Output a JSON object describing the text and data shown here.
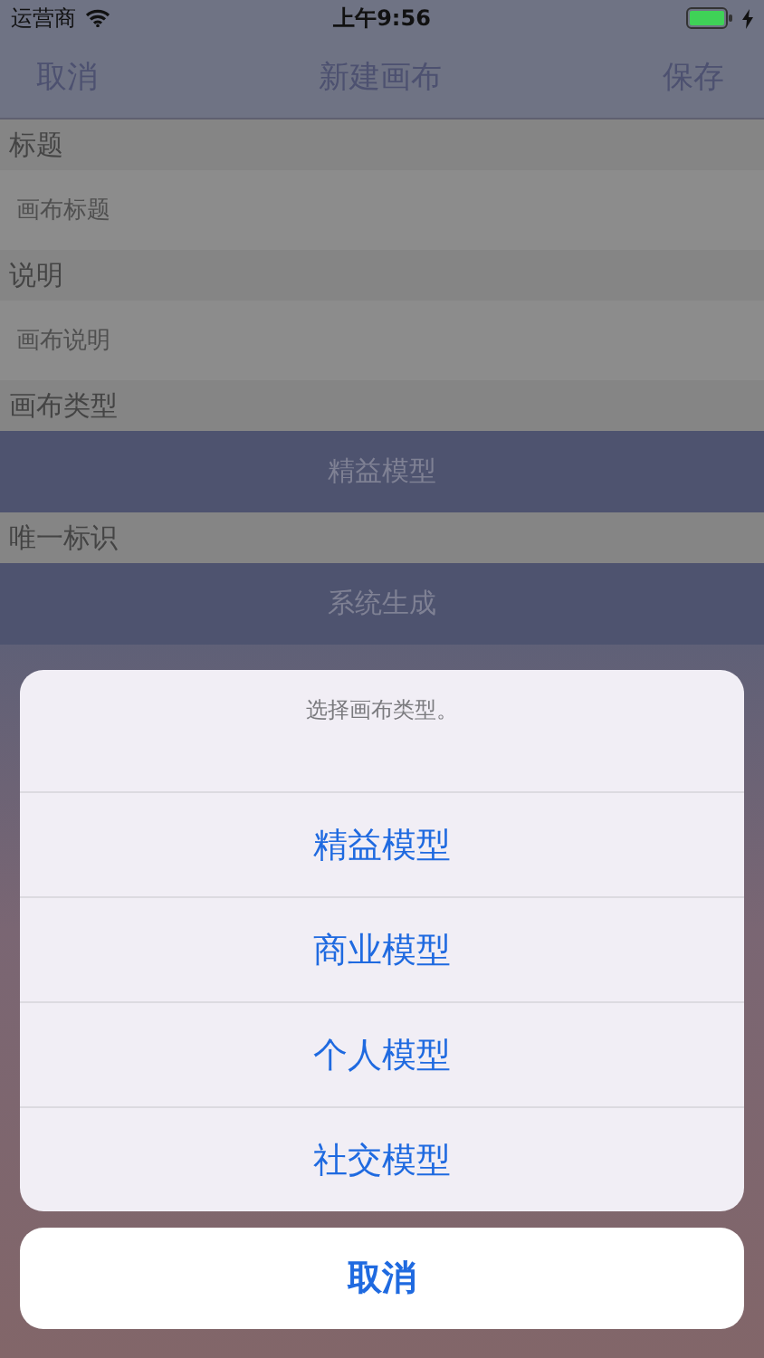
{
  "status_bar": {
    "carrier": "运营商",
    "time": "上午9:56"
  },
  "nav": {
    "left": "取消",
    "title": "新建画布",
    "right": "保存"
  },
  "form": [
    {
      "kind": "field",
      "label": "标题",
      "placeholder": "画布标题"
    },
    {
      "kind": "field",
      "label": "说明",
      "placeholder": "画布说明"
    },
    {
      "kind": "button",
      "label": "画布类型",
      "value": "精益模型"
    },
    {
      "kind": "button",
      "label": "唯一标识",
      "value": "系统生成"
    }
  ],
  "action_sheet": {
    "message": "选择画布类型。",
    "options": [
      "精益模型",
      "商业模型",
      "个人模型",
      "社交模型"
    ],
    "cancel": "取消"
  }
}
